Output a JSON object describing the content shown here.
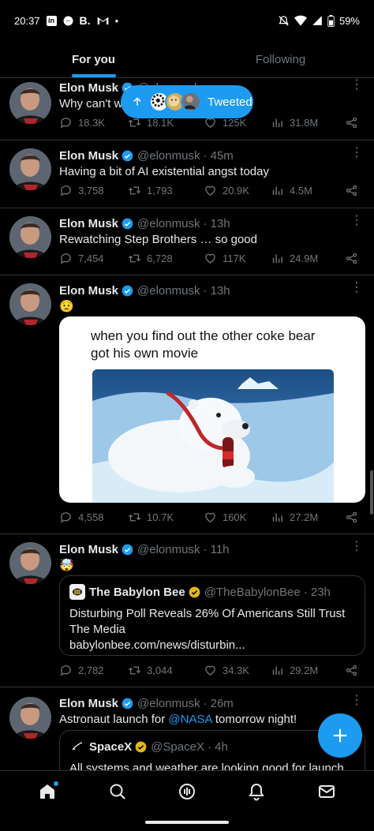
{
  "status_bar": {
    "time": "20:37",
    "battery": "59%"
  },
  "tabs": [
    {
      "label": "For you",
      "active": true
    },
    {
      "label": "Following",
      "active": false
    }
  ],
  "new_tweets_pill": {
    "label": "Tweeted"
  },
  "tweets": [
    {
      "name": "Elon Musk",
      "handle": "@elonmusk",
      "time": "",
      "text": "Why can't wi",
      "replies": "18.3K",
      "retweets": "18.1K",
      "likes": "125K",
      "views": "31.8M"
    },
    {
      "name": "Elon Musk",
      "handle": "@elonmusk",
      "time": "· 45m",
      "text": "Having a bit of AI existential angst today",
      "replies": "3,758",
      "retweets": "1,793",
      "likes": "20.9K",
      "views": "4.5M"
    },
    {
      "name": "Elon Musk",
      "handle": "@elonmusk",
      "time": "· 13h",
      "text": "Rewatching Step Brothers … so good",
      "replies": "7,454",
      "retweets": "6,728",
      "likes": "117K",
      "views": "24.9M"
    },
    {
      "name": "Elon Musk",
      "handle": "@elonmusk",
      "time": "· 13h",
      "text": "😟",
      "media_caption": "when you find out the other coke bear got his own movie",
      "replies": "4,558",
      "retweets": "10.7K",
      "likes": "160K",
      "views": "27.2M"
    },
    {
      "name": "Elon Musk",
      "handle": "@elonmusk",
      "time": "· 11h",
      "text": "🤯",
      "quote": {
        "name": "The Babylon Bee",
        "handle": "@TheBabylonBee",
        "time": "· 23h",
        "text": "Disturbing Poll Reveals 26% Of Americans Still Trust The Media",
        "link": "babylonbee.com/news/disturbin..."
      },
      "replies": "2,782",
      "retweets": "3,044",
      "likes": "34.3K",
      "views": "29.2M"
    },
    {
      "name": "Elon Musk",
      "handle": "@elonmusk",
      "time": "· 26m",
      "text_before": "Astronaut launch for ",
      "text_link": "@NASA",
      "text_after": " tomorrow night!",
      "quote": {
        "name": "SpaceX",
        "handle": "@SpaceX",
        "time": "· 4h",
        "text": "All systems and weather are looking good for launch of"
      }
    }
  ],
  "colors": {
    "accent": "#1d9bf0",
    "gold_check": "#e2b719",
    "muted": "#71767b",
    "divider": "#2f3336"
  },
  "icons": [
    "home-icon",
    "search-icon",
    "spaces-icon",
    "notifications-icon",
    "messages-icon",
    "compose-icon"
  ]
}
